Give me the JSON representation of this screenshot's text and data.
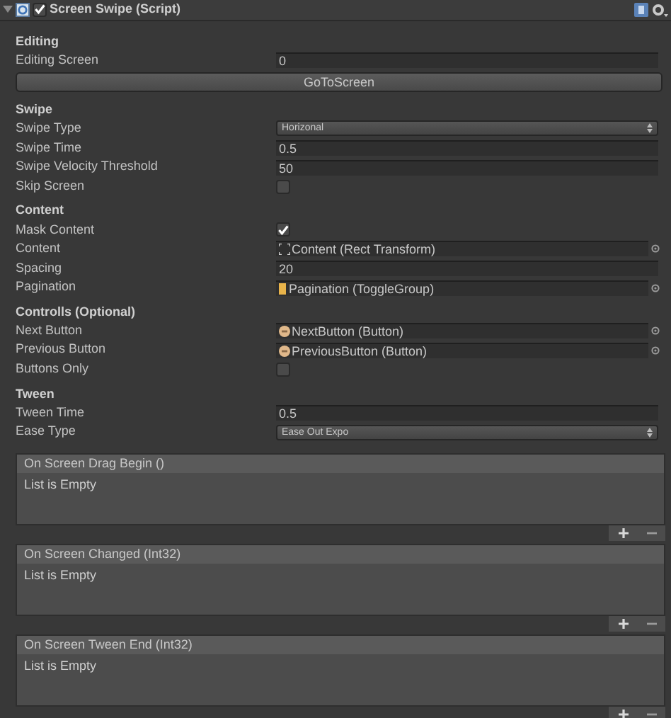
{
  "component": {
    "title": "Screen Swipe (Script)",
    "expanded": true,
    "enabled": true
  },
  "sections": [
    {
      "title": "Editing",
      "fields": [
        {
          "label": "Editing Screen",
          "kind": "number",
          "value": "0"
        },
        {
          "kind": "button",
          "value": "GoToScreen"
        }
      ]
    },
    {
      "title": "Swipe",
      "fields": [
        {
          "label": "Swipe Type",
          "kind": "popup",
          "value": "Horizonal"
        },
        {
          "label": "Swipe Time",
          "kind": "number",
          "value": "0.5"
        },
        {
          "label": "Swipe Velocity Threshold",
          "kind": "number",
          "value": "50"
        },
        {
          "label": "Skip Screen",
          "kind": "toggle",
          "checked": false
        }
      ]
    },
    {
      "title": "Content",
      "fields": [
        {
          "label": "Mask Content",
          "kind": "toggle",
          "checked": true
        },
        {
          "label": "Content",
          "kind": "rect_object",
          "value": "Content (Rect Transform)"
        },
        {
          "label": "Spacing",
          "kind": "number",
          "value": "20"
        },
        {
          "label": "Pagination",
          "kind": "group_object",
          "value": "Pagination (ToggleGroup)"
        }
      ]
    },
    {
      "title": "Controlls (Optional)",
      "fields": [
        {
          "label": "Next Button",
          "kind": "button_object",
          "value": "NextButton (Button)"
        },
        {
          "label": "Previous Button",
          "kind": "button_object",
          "value": "PreviousButton (Button)"
        },
        {
          "label": "Buttons Only",
          "kind": "toggle",
          "checked": false
        }
      ]
    },
    {
      "title": "Tween",
      "fields": [
        {
          "label": "Tween Time",
          "kind": "number",
          "value": "0.5"
        },
        {
          "label": "Ease Type",
          "kind": "popup",
          "value": "Ease Out Expo"
        }
      ]
    }
  ],
  "events": [
    {
      "title": "On Screen Drag Begin ()",
      "empty_text": "List is Empty"
    },
    {
      "title": "On Screen Changed (Int32)",
      "empty_text": "List is Empty"
    },
    {
      "title": "On Screen Tween End (Int32)",
      "empty_text": "List is Empty"
    }
  ]
}
